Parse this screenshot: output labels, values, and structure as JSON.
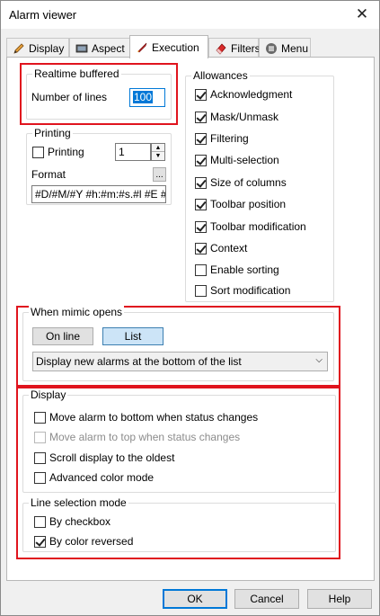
{
  "window": {
    "title": "Alarm viewer"
  },
  "tabs": [
    {
      "label": "Display"
    },
    {
      "label": "Aspect"
    },
    {
      "label": "Execution"
    },
    {
      "label": "Filters"
    },
    {
      "label": "Menu"
    }
  ],
  "realtime": {
    "group_label": "Realtime buffered",
    "lines_label": "Number of lines",
    "lines_value": "100"
  },
  "printing": {
    "group_label": "Printing",
    "checkbox_label": "Printing",
    "copies_value": "1",
    "format_label": "Format",
    "browse_label": "...",
    "format_value": "#D/#M/#Y #h:#m:#s.#l #E #T"
  },
  "allowances": {
    "group_label": "Allowances",
    "items": [
      {
        "label": "Acknowledgment"
      },
      {
        "label": "Mask/Unmask"
      },
      {
        "label": "Filtering"
      },
      {
        "label": "Multi-selection"
      },
      {
        "label": "Size of columns"
      },
      {
        "label": "Toolbar position"
      },
      {
        "label": "Toolbar modification"
      },
      {
        "label": "Context"
      },
      {
        "label": "Enable sorting"
      },
      {
        "label": "Sort modification"
      }
    ]
  },
  "mimic": {
    "group_label": "When mimic opens",
    "online_label": "On line",
    "list_label": "List",
    "dropdown_value": "Display new alarms at the bottom of the list"
  },
  "display": {
    "group_label": "Display",
    "items": [
      {
        "label": "Move alarm to bottom when status changes"
      },
      {
        "label": "Move alarm to top when status changes"
      },
      {
        "label": "Scroll display to the oldest"
      },
      {
        "label": "Advanced color mode"
      }
    ]
  },
  "line_selection": {
    "group_label": "Line selection mode",
    "items": [
      {
        "label": "By checkbox"
      },
      {
        "label": "By color reversed"
      }
    ]
  },
  "footer": {
    "ok_label": "OK",
    "cancel_label": "Cancel",
    "help_label": "Help"
  },
  "colors": {
    "highlight": "#e0141e",
    "accent": "#0078d7"
  }
}
